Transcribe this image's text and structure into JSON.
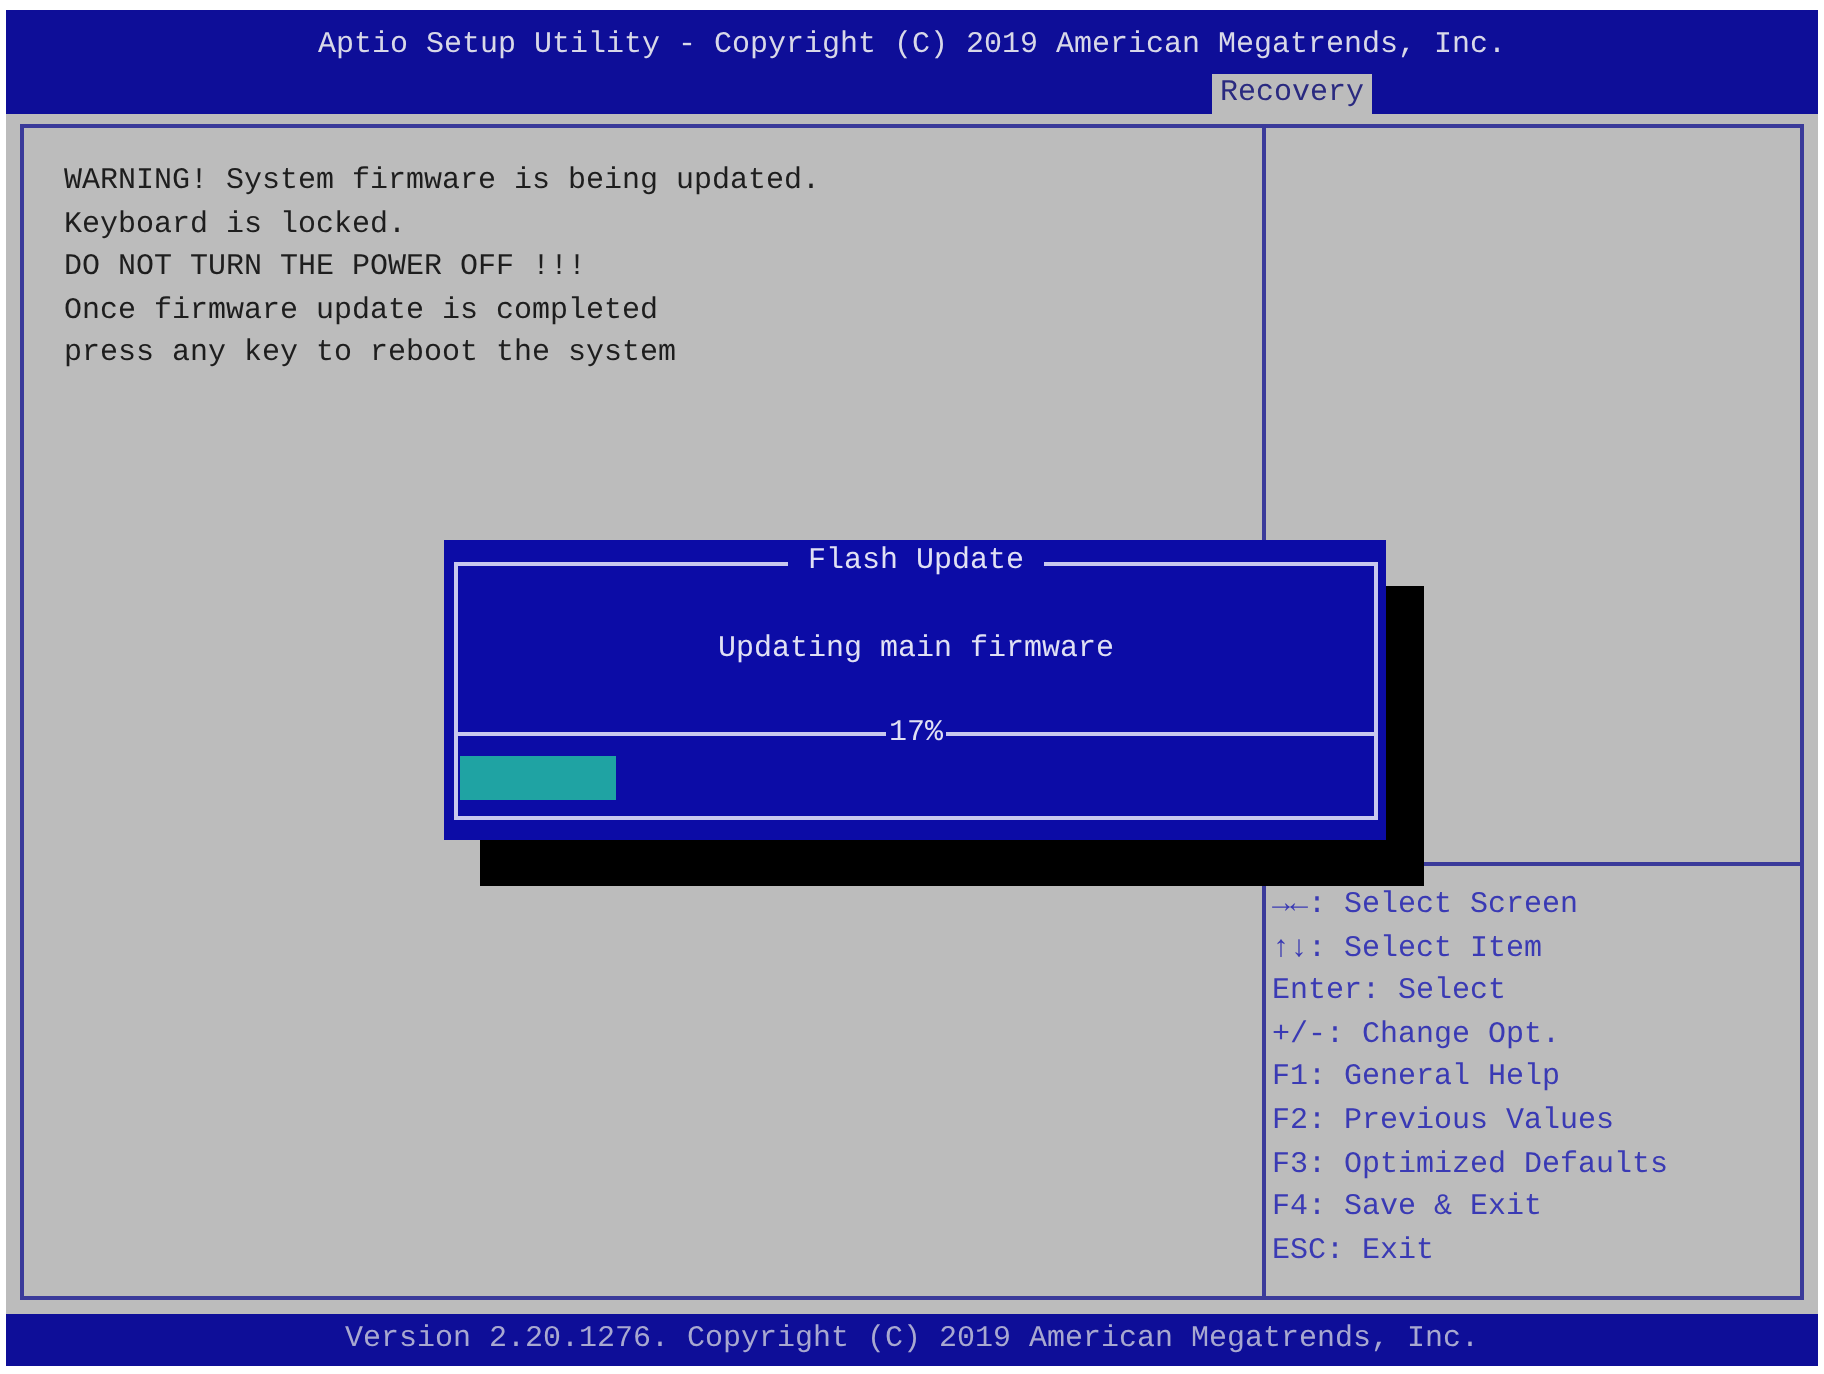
{
  "header": {
    "title": "Aptio Setup Utility - Copyright (C) 2019 American Megatrends, Inc.",
    "tabs": [
      {
        "label": "Recovery",
        "selected": true
      }
    ]
  },
  "main_panel": {
    "lines": [
      "WARNING! System firmware is being updated.",
      "Keyboard is locked.",
      "DO NOT TURN THE POWER OFF !!!",
      "Once firmware update is completed",
      "press any key to reboot the system"
    ]
  },
  "help_panel": {
    "lines": [
      "→←: Select Screen",
      "↑↓: Select Item",
      "Enter: Select",
      "+/-: Change Opt.",
      "F1: General Help",
      "F2: Previous Values",
      "F3: Optimized Defaults",
      "F4: Save & Exit",
      "ESC: Exit"
    ]
  },
  "dialog": {
    "title": "Flash Update",
    "message": "Updating main firmware",
    "progress": {
      "reading": "17%",
      "level": 0.17
    }
  },
  "footer": {
    "text": "Version 2.20.1276. Copyright (C) 2019 American Megatrends, Inc."
  }
}
